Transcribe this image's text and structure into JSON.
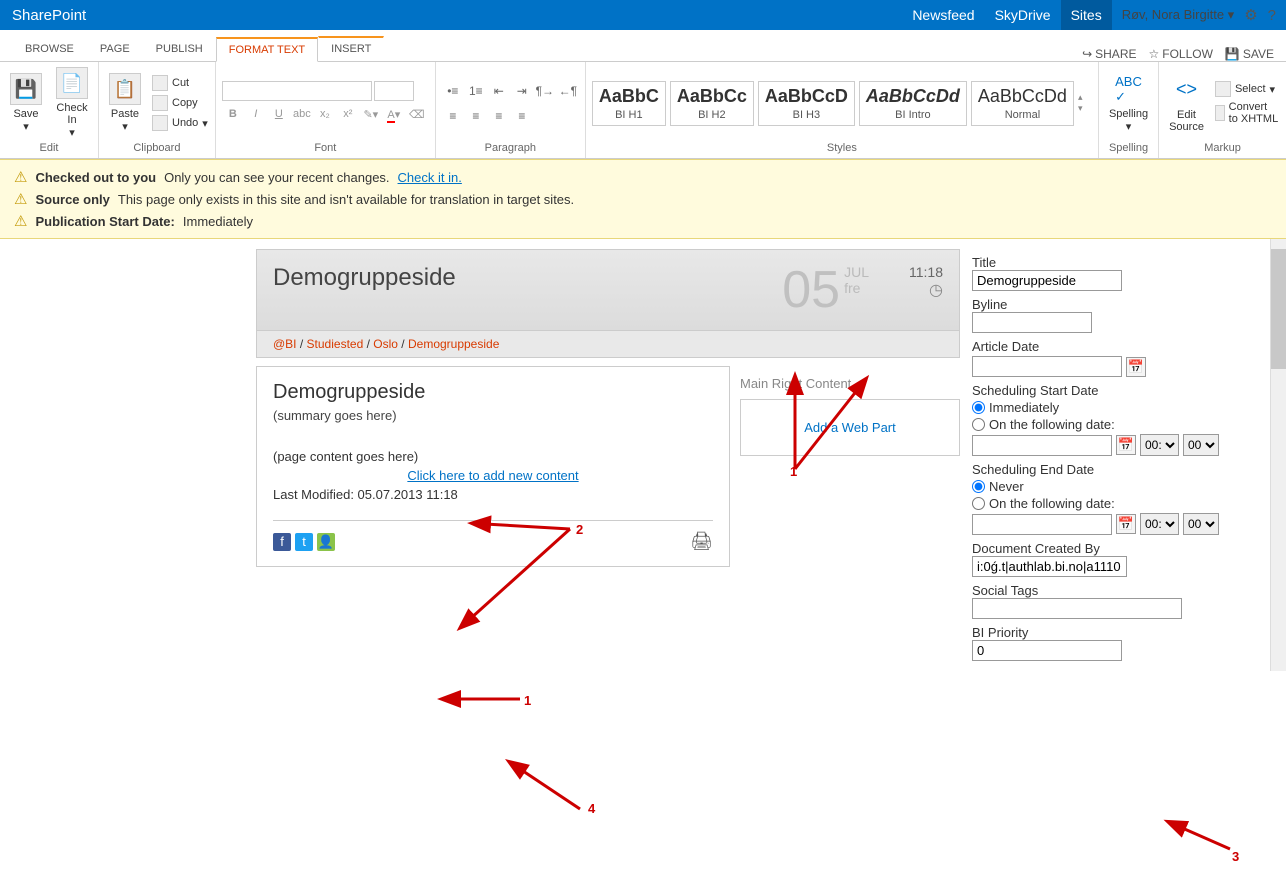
{
  "topbar": {
    "brand": "SharePoint",
    "links": [
      "Newsfeed",
      "SkyDrive",
      "Sites"
    ],
    "active_link": 2,
    "user": "Røv, Nora Birgitte"
  },
  "tabs": {
    "items": [
      "BROWSE",
      "PAGE",
      "PUBLISH",
      "FORMAT TEXT",
      "INSERT"
    ],
    "active": 3,
    "right": {
      "share": "SHARE",
      "follow": "FOLLOW",
      "save": "SAVE"
    }
  },
  "ribbon": {
    "edit": {
      "label": "Edit",
      "save": "Save",
      "checkin": "Check In"
    },
    "clipboard": {
      "label": "Clipboard",
      "paste": "Paste",
      "cut": "Cut",
      "copy": "Copy",
      "undo": "Undo"
    },
    "font": {
      "label": "Font",
      "family": "",
      "size": ""
    },
    "paragraph": {
      "label": "Paragraph"
    },
    "styles": {
      "label": "Styles",
      "items": [
        {
          "preview": "AaBbC",
          "name": "BI H1"
        },
        {
          "preview": "AaBbCc",
          "name": "BI H2"
        },
        {
          "preview": "AaBbCcD",
          "name": "BI H3"
        },
        {
          "preview": "AaBbCcDd",
          "name": "BI Intro",
          "italic": true
        },
        {
          "preview": "AaBbCcDd",
          "name": "Normal"
        }
      ]
    },
    "spelling": {
      "label": "Spelling",
      "btn": "Spelling"
    },
    "markup": {
      "label": "Markup",
      "edit_source": "Edit Source",
      "select": "Select",
      "convert": "Convert to XHTML"
    }
  },
  "notices": [
    {
      "bold": "Checked out to you",
      "text": "Only you can see your recent changes.",
      "link": "Check it in."
    },
    {
      "bold": "Source only",
      "text": "This page only exists in this site and isn't available for translation in target sites."
    },
    {
      "bold": "Publication Start Date:",
      "text": "Immediately"
    }
  ],
  "hero": {
    "title": "Demogruppeside",
    "day": "05",
    "month": "JUL",
    "weekday": "fre",
    "time": "11:18"
  },
  "breadcrumb": [
    "@BI",
    "Studiested",
    "Oslo",
    "Demogruppeside"
  ],
  "content": {
    "heading": "Demogruppeside",
    "summary": "(summary goes here)",
    "page_content": "(page content goes here)",
    "add_link": "Click here to add new content",
    "last_modified": "Last Modified: 05.07.2013 11:18"
  },
  "right_zone": {
    "label": "Main Right Content",
    "add": "Add a Web Part"
  },
  "sidebar": {
    "title_label": "Title",
    "title_value": "Demogruppeside",
    "byline_label": "Byline",
    "byline_value": "",
    "article_date_label": "Article Date",
    "sched_start_label": "Scheduling Start Date",
    "immediately": "Immediately",
    "on_following": "On the following date:",
    "sched_end_label": "Scheduling End Date",
    "never": "Never",
    "doc_created_label": "Document Created By",
    "doc_created_value": "i:0ǵ.t|authlab.bi.no|a1110",
    "social_tags_label": "Social Tags",
    "priority_label": "BI Priority",
    "priority_value": "0",
    "hour": "00:",
    "minute": "00"
  },
  "annotations": {
    "a1": "1",
    "a2": "2",
    "a3": "3",
    "a4": "4"
  }
}
